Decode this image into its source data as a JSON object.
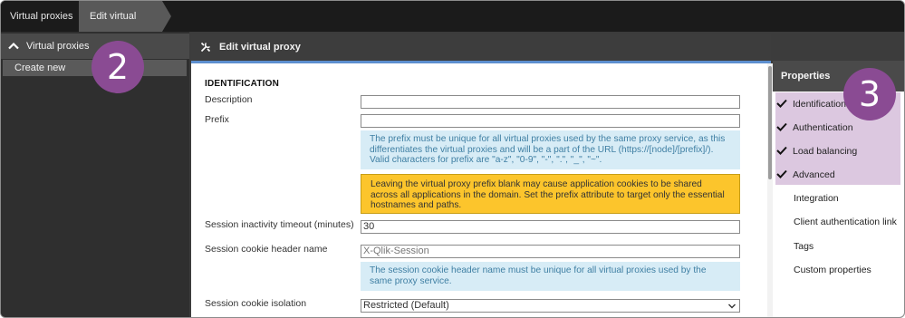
{
  "breadcrumb": {
    "items": [
      {
        "label": "Virtual proxies"
      },
      {
        "label": "Edit virtual proxy"
      }
    ]
  },
  "sidebar": {
    "header": "Virtual proxies",
    "items": [
      {
        "label": "Create new"
      }
    ]
  },
  "callouts": {
    "two": "2",
    "three": "3"
  },
  "main": {
    "title": "Edit virtual proxy",
    "section_title": "IDENTIFICATION",
    "fields": {
      "description": {
        "label": "Description",
        "value": ""
      },
      "prefix": {
        "label": "Prefix",
        "value": ""
      },
      "prefix_info": "The prefix must be unique for all virtual proxies used by the same proxy service, as this differentiates the virtual proxies and will be a part of the URL (https://[node]/[prefix]/). Valid characters for prefix are \"a-z\", \"0-9\", \"-\", \".\", \"_\", \"~\".",
      "prefix_warning": "Leaving the virtual proxy prefix blank may cause application cookies to be shared across all applications in the domain. Set the prefix attribute to target only the essential hostnames and paths.",
      "session_timeout": {
        "label": "Session inactivity timeout (minutes)",
        "value": "30"
      },
      "cookie_header": {
        "label": "Session cookie header name",
        "value": "X-Qlik-Session"
      },
      "cookie_header_info": "The session cookie header name must be unique for all virtual proxies used by the same proxy service.",
      "cookie_isolation": {
        "label": "Session cookie isolation",
        "value": "Restricted (Default)"
      }
    }
  },
  "properties": {
    "title": "Properties",
    "items": [
      {
        "label": "Identification",
        "checked": true
      },
      {
        "label": "Authentication",
        "checked": true
      },
      {
        "label": "Load balancing",
        "checked": true
      },
      {
        "label": "Advanced",
        "checked": true
      },
      {
        "label": "Integration",
        "checked": false
      },
      {
        "label": "Client authentication link",
        "checked": false
      },
      {
        "label": "Tags",
        "checked": false
      },
      {
        "label": "Custom properties",
        "checked": false
      }
    ]
  },
  "colors": {
    "callout": "#8a4b93",
    "selection": "#dcc8e0",
    "warning": "#fcc52c",
    "info": "#d7ecf6",
    "accent": "#5d8fcf"
  },
  "icons": {
    "sidebar_toggle": "chevron-up-icon",
    "header": "tools-icon",
    "select_arrow": "chevron-down-icon",
    "property_done": "check-icon"
  }
}
